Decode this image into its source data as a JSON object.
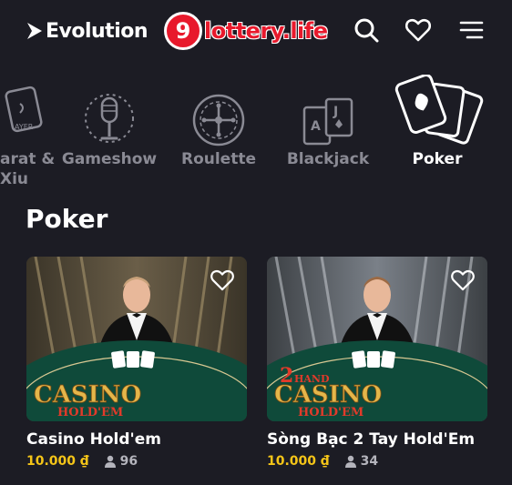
{
  "header": {
    "brand_left": "Evolution",
    "brand_center": "lottery.life",
    "brand_center_badge": "9",
    "icons": [
      "search-icon",
      "heart-icon",
      "menu-icon"
    ]
  },
  "categories": [
    {
      "label": "arat &\nXiu",
      "icon": "baccarat-icon",
      "active": false
    },
    {
      "label": "Gameshow",
      "icon": "microphone-icon",
      "active": false
    },
    {
      "label": "Roulette",
      "icon": "roulette-icon",
      "active": false
    },
    {
      "label": "Blackjack",
      "icon": "cards-icon",
      "active": false
    },
    {
      "label": "Poker",
      "icon": "poker-cards-icon",
      "active": true
    }
  ],
  "section": {
    "title": "Poker"
  },
  "games": [
    {
      "title": "Casino Hold'em",
      "price": "10.000 ₫",
      "players": "96",
      "art_text": "CASINO HOLD'EM"
    },
    {
      "title": "Sòng Bạc 2 Tay Hold'Em",
      "price": "10.000 ₫",
      "players": "34",
      "art_text": "2 HAND CASINO HOLD'EM"
    }
  ],
  "colors": {
    "background": "#1c1c24",
    "accent": "#e8192c",
    "price": "#f5c518",
    "muted": "#8a8a94"
  }
}
